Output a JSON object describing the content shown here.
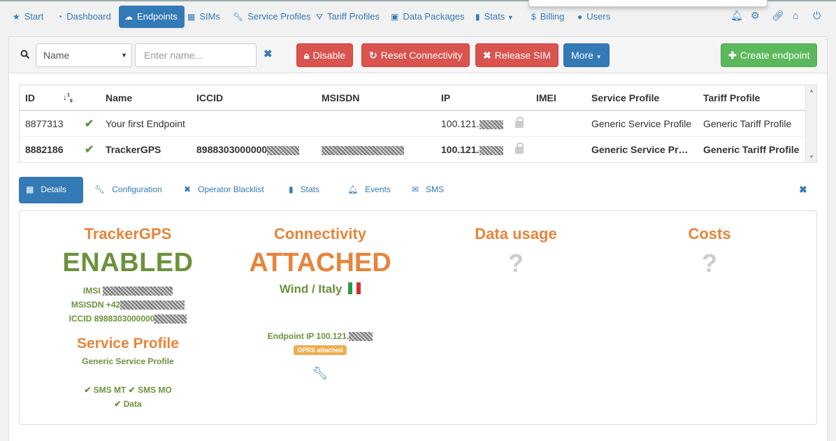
{
  "nav": {
    "items": [
      {
        "label": "Start",
        "icon": "star-icon"
      },
      {
        "label": "Dashboard",
        "icon": "dashboard-icon"
      },
      {
        "label": "Endpoints",
        "icon": "cloud-icon",
        "active": true
      },
      {
        "label": "SIMs",
        "icon": "grid-icon"
      },
      {
        "label": "Service Profiles",
        "icon": "wrench-icon"
      },
      {
        "label": "Tariff Profiles",
        "icon": "road-icon"
      },
      {
        "label": "Data Packages",
        "icon": "briefcase-icon"
      },
      {
        "label": "Stats",
        "icon": "bar-chart-icon"
      },
      {
        "label": "Billing",
        "icon": "dollar-icon"
      },
      {
        "label": "Users",
        "icon": "user-icon"
      }
    ],
    "right_icons": [
      "bell-icon",
      "gear-icon",
      "link-icon",
      "home-icon",
      "power-icon"
    ]
  },
  "toolbar": {
    "filter_select": "Name",
    "name_placeholder": "Enter name...",
    "disable_label": "Disable",
    "reset_label": "Reset Connectivity",
    "release_label": "Release SIM",
    "more_label": "More",
    "create_label": "Create endpoint"
  },
  "table": {
    "headers": [
      "ID",
      "",
      "Name",
      "ICCID",
      "MSISDN",
      "IP",
      "IMEI",
      "Service Profile",
      "Tariff Profile"
    ],
    "rows": [
      {
        "id": "8877313",
        "name": "Your first Endpoint",
        "iccid": "",
        "msisdn": "",
        "ip": "100.121.",
        "imei": "",
        "service_profile": "Generic Service Profile",
        "tariff_profile": "Generic Tariff Profile"
      },
      {
        "id": "8882186",
        "name": "TrackerGPS",
        "iccid": "8988303000000",
        "msisdn": "",
        "ip": "100.121.",
        "imei": "",
        "service_profile": "Generic Service Pr…",
        "tariff_profile": "Generic Tariff Profile"
      }
    ]
  },
  "tabs": [
    {
      "label": "Details",
      "icon": "grid-icon",
      "active": true
    },
    {
      "label": "Configuration",
      "icon": "wrench-icon"
    },
    {
      "label": "Operator Blacklist",
      "icon": "close-icon"
    },
    {
      "label": "Stats",
      "icon": "bar-chart-icon"
    },
    {
      "label": "Events",
      "icon": "bell-icon"
    },
    {
      "label": "SMS",
      "icon": "envelope-icon"
    }
  ],
  "details": {
    "endpoint_name": "TrackerGPS",
    "status": "ENABLED",
    "imsi_label": "IMSI",
    "msisdn_label": "MSISDN +42",
    "iccid_label": "ICCID 8988303000000",
    "service_profile_title": "Service Profile",
    "service_profile_name": "Generic Service Profile",
    "features": [
      "SMS MT",
      "SMS MO",
      "Data"
    ],
    "connectivity_title": "Connectivity",
    "connectivity_status": "ATTACHED",
    "carrier": "Wind / Italy",
    "endpoint_ip_label": "Endpoint IP 100.121.",
    "gprs_badge": "GPRS attached",
    "data_usage_title": "Data usage",
    "data_usage_value": "?",
    "costs_title": "Costs",
    "costs_value": "?"
  },
  "colors": {
    "primary": "#337ab7",
    "danger": "#d9534f",
    "success": "#5cb85c",
    "orange": "#e8843a",
    "green": "#6b923c",
    "warning": "#f0ad4e"
  }
}
